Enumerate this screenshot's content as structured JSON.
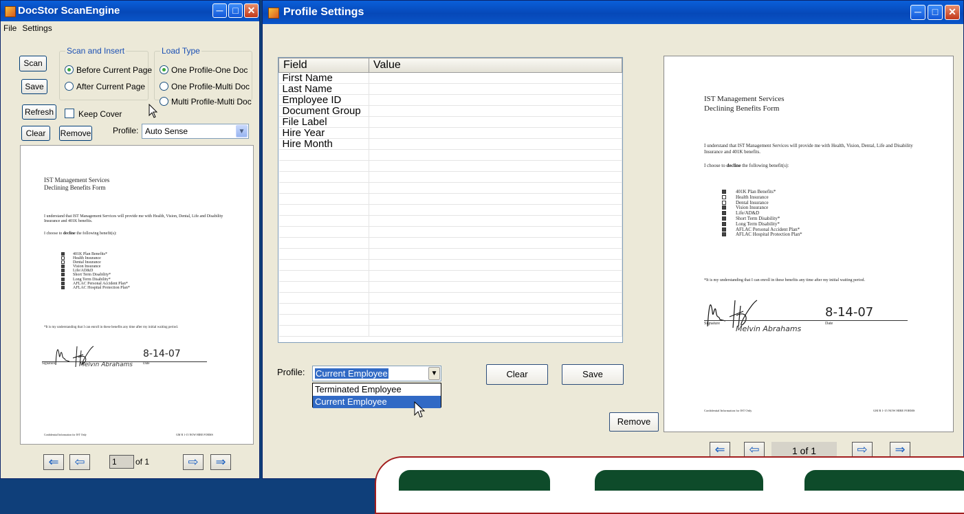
{
  "scan_window": {
    "title": "DocStor ScanEngine",
    "menu": [
      "File",
      "Settings"
    ],
    "buttons": {
      "scan": "Scan",
      "save": "Save",
      "refresh": "Refresh",
      "clear": "Clear",
      "remove": "Remove"
    },
    "scan_insert": {
      "legend": "Scan and Insert",
      "before": "Before Current Page",
      "after": "After Current Page",
      "selected": "Before Current Page"
    },
    "load_type": {
      "legend": "Load Type",
      "options": [
        "One Profile-One Doc",
        "One Profile-Multi Doc",
        "Multi Profile-Multi Doc"
      ],
      "selected": "One Profile-One Doc"
    },
    "keep_cover": "Keep Cover",
    "profile_label": "Profile:",
    "profile_value": "Auto Sense",
    "page_input": "1",
    "page_of": "of 1"
  },
  "profile_window": {
    "title": "Profile Settings",
    "grid_headers": [
      "Field",
      "Value"
    ],
    "grid_rows": [
      "First Name",
      "Last Name",
      "Employee ID",
      "Document Group",
      "File Label",
      "Hire Year",
      "Hire Month"
    ],
    "profile_label": "Profile:",
    "profile_value": "Current Employee",
    "dropdown_options": [
      "Terminated Employee",
      "Current Employee"
    ],
    "dropdown_highlighted": "Current Employee",
    "clear_label": "Clear",
    "save_label": "Save",
    "remove_label": "Remove",
    "pager_text": "1 of 1"
  },
  "document": {
    "company": "IST Management Services",
    "form_title": "Declining Benefits Form",
    "para1": "I understand that IST Management Services will provide me with Health, Vision, Dental, Life and Disability Insurance and 401K benefits.",
    "para2_prefix": "I choose to ",
    "para2_bold": "decline",
    "para2_suffix": " the following benefit(s):",
    "benefits": [
      "401K Plan Benefits*",
      "Health Insurance",
      "Dental Insurance",
      "Vision Insurance",
      "Life/AD&D",
      "Short Term Disability*",
      "Long Term Disability*",
      "AFLAC Personal Accident Plan*",
      "AFLAC Hospital Protection Plan*"
    ],
    "benefit_checked": [
      true,
      false,
      false,
      true,
      true,
      true,
      true,
      true,
      true
    ],
    "note": "*It is my understanding that I can enroll in these benefits any time after my initial waiting period.",
    "signature_label": "Signature",
    "date_label": "Date",
    "signed_name": "Melvin Abrahams",
    "signed_date": "8-14-07",
    "footer_left": "Confidential Information for IST Only",
    "footer_right": "GM R 1-15 NOW HIRE FORMS"
  }
}
